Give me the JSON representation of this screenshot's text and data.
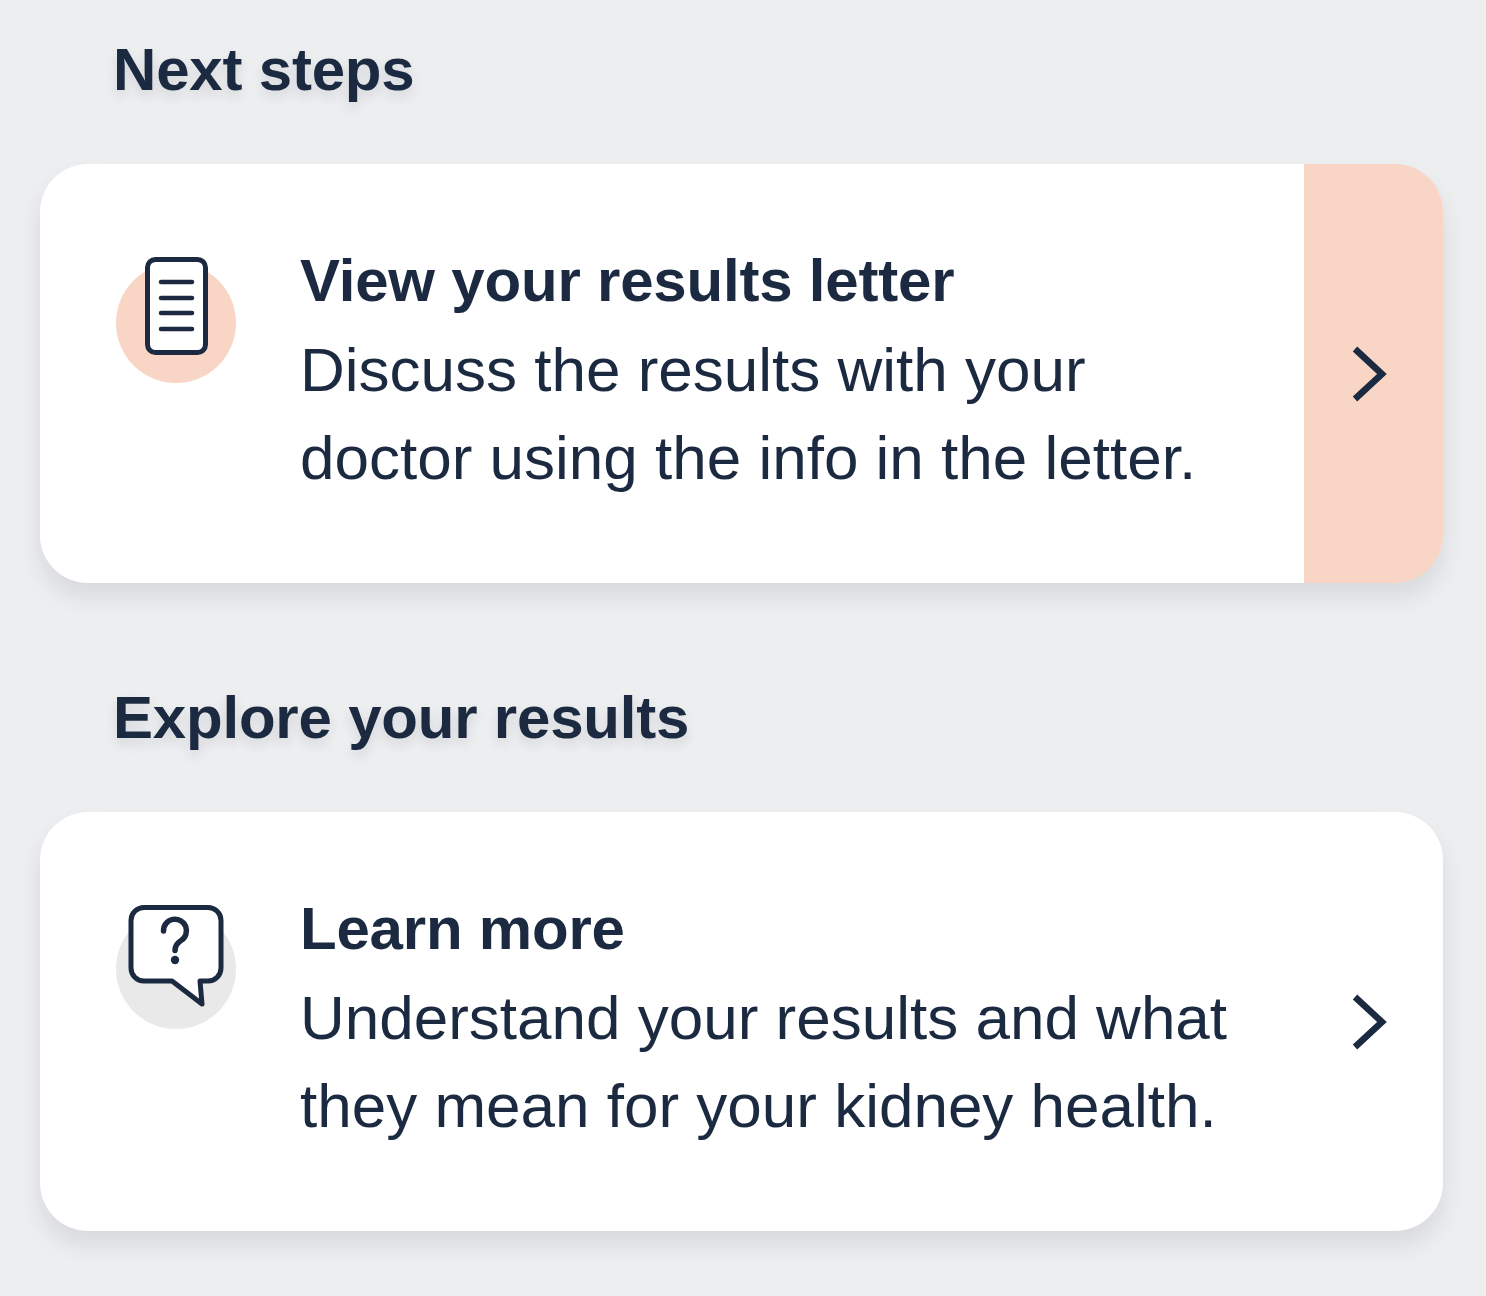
{
  "sections": [
    {
      "heading": "Next steps",
      "cards": [
        {
          "kind": "document",
          "title": "View your results letter",
          "description": "Discuss the results with your doctor using the info in the letter.",
          "highlighted": true
        }
      ]
    },
    {
      "heading": "Explore your results",
      "cards": [
        {
          "kind": "question",
          "title": "Learn more",
          "description": "Understand your results and what they mean for your kidney health.",
          "highlighted": false
        }
      ]
    }
  ]
}
